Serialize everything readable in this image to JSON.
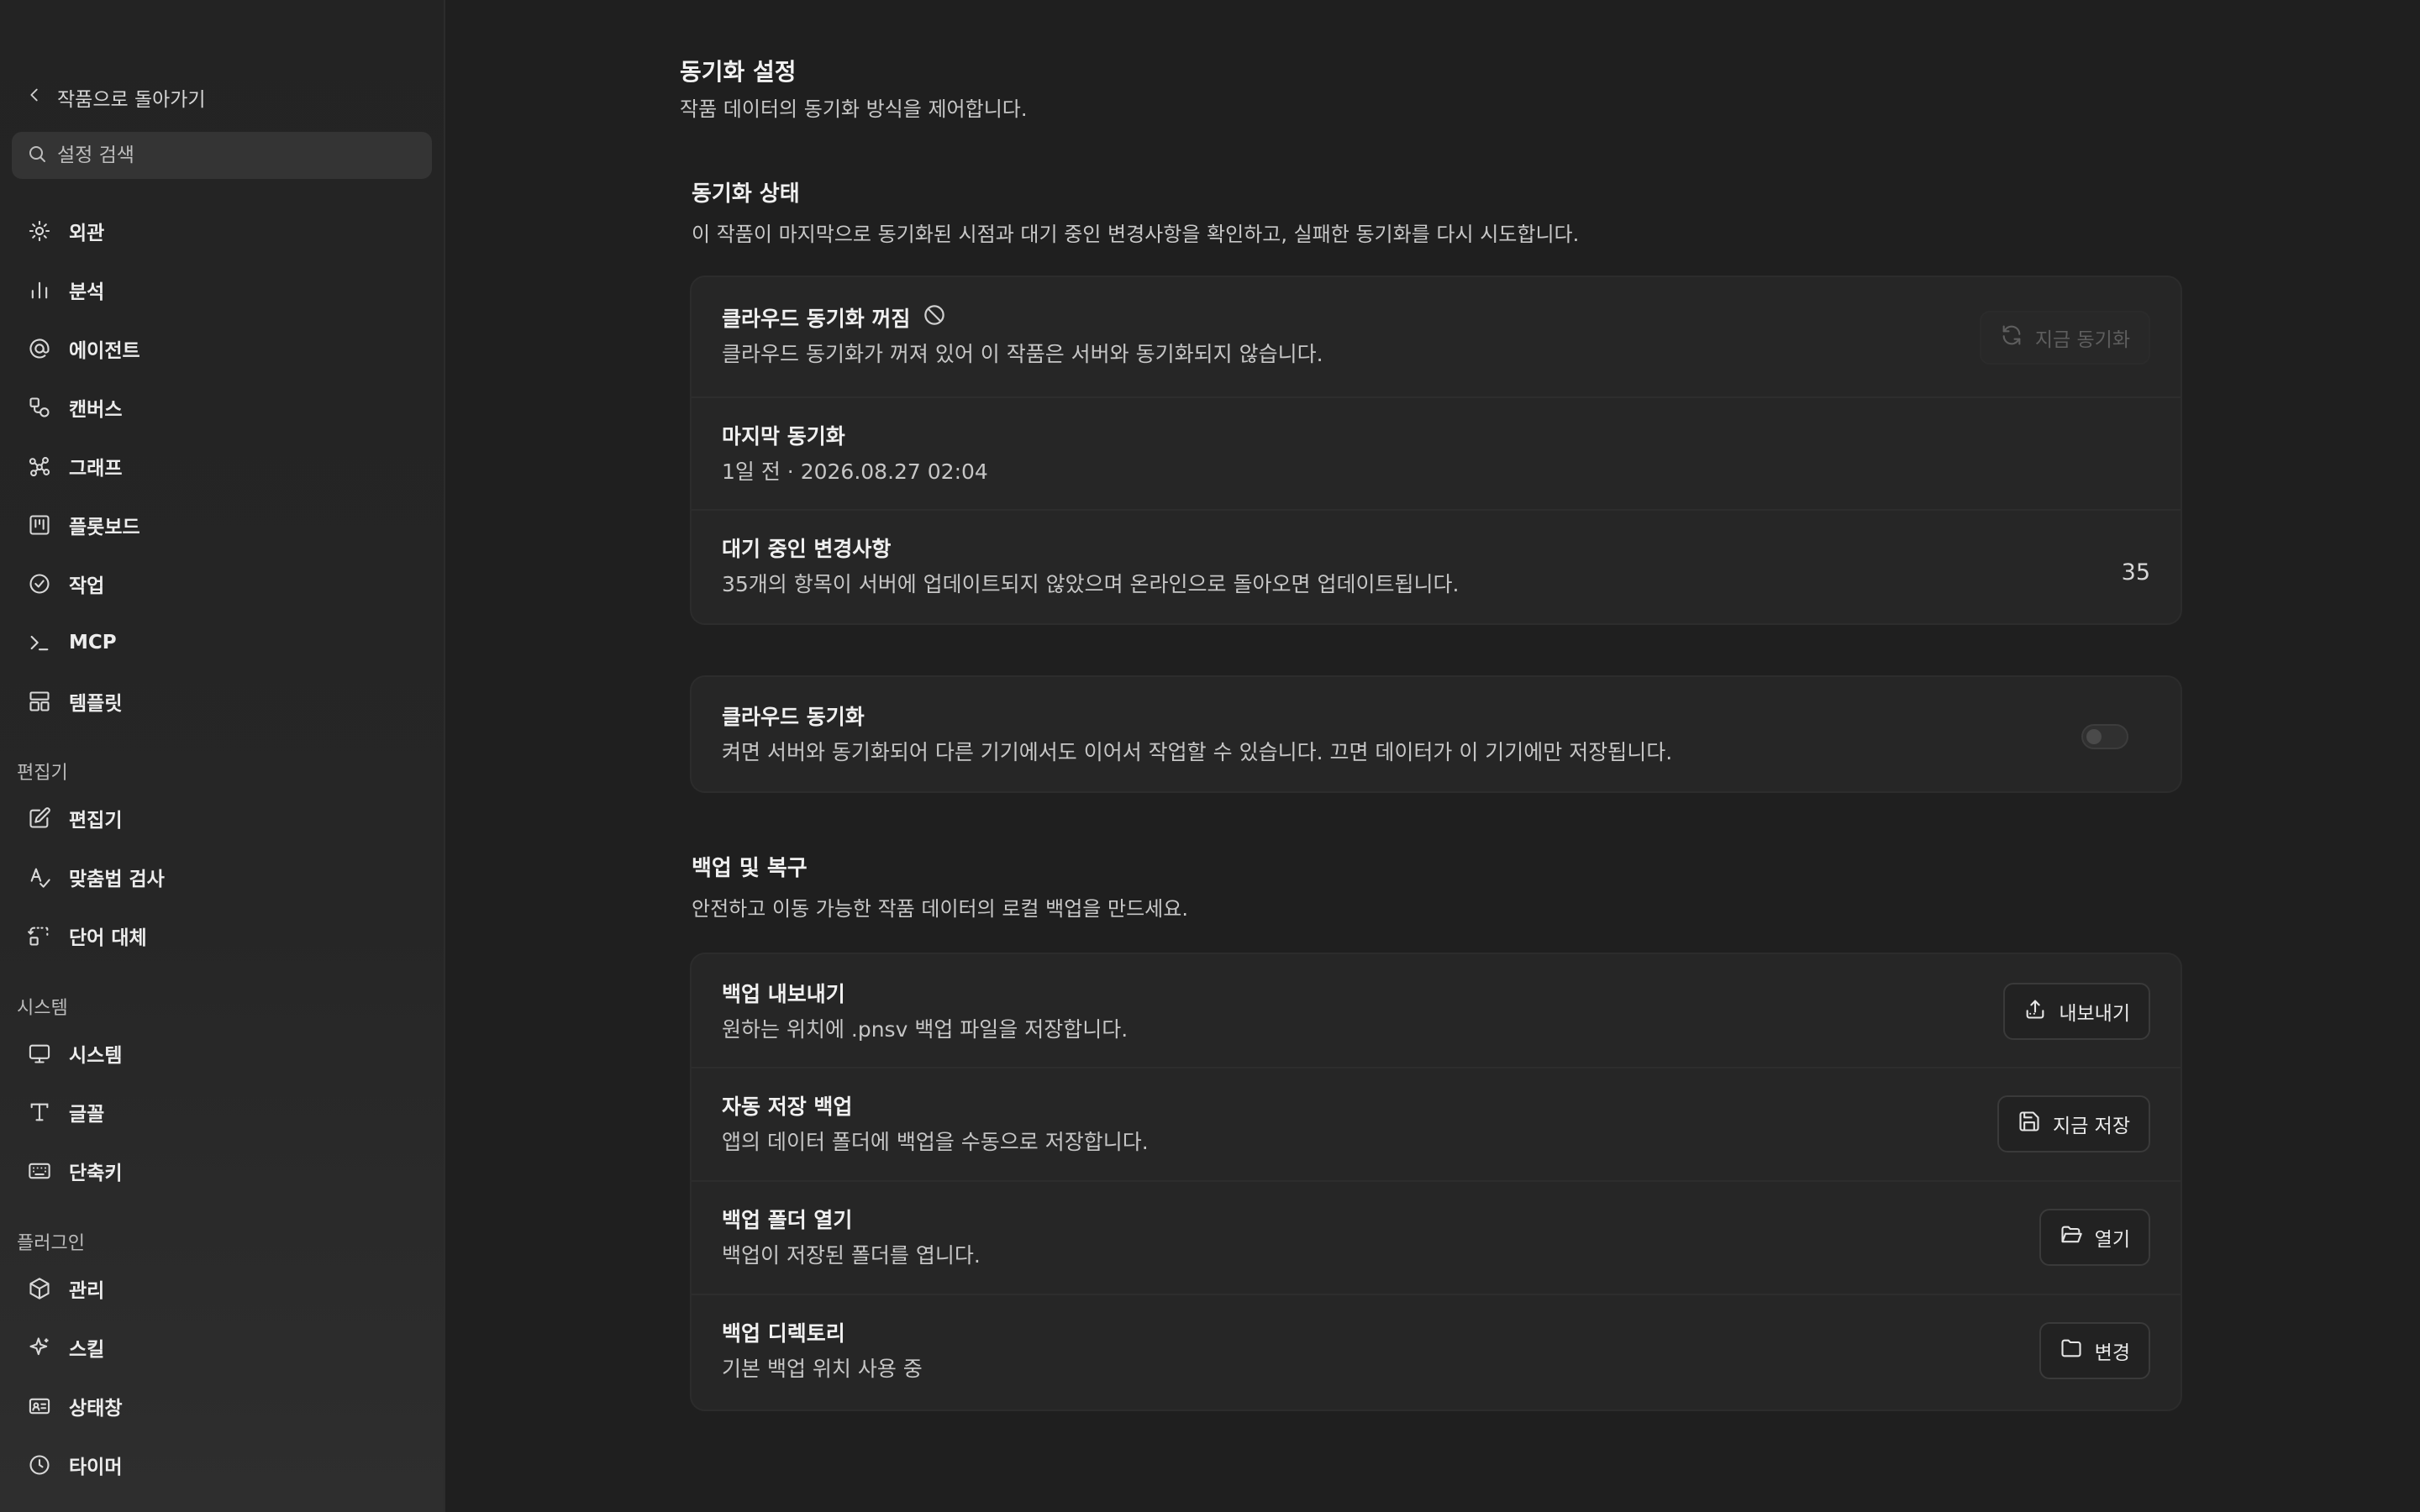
{
  "sidebar": {
    "back_label": "작품으로 돌아가기",
    "search_placeholder": "설정 검색",
    "groups": [
      {
        "label": "",
        "items": [
          {
            "label": "외관",
            "icon": "sun-icon"
          },
          {
            "label": "분석",
            "icon": "bar-chart-icon"
          },
          {
            "label": "에이전트",
            "icon": "at-sign-icon"
          },
          {
            "label": "캔버스",
            "icon": "canvas-shapes-icon"
          },
          {
            "label": "그래프",
            "icon": "graph-nodes-icon"
          },
          {
            "label": "플롯보드",
            "icon": "kanban-icon"
          },
          {
            "label": "작업",
            "icon": "check-circle-icon"
          },
          {
            "label": "MCP",
            "icon": "terminal-icon"
          },
          {
            "label": "템플릿",
            "icon": "layout-template-icon"
          }
        ]
      },
      {
        "label": "편집기",
        "items": [
          {
            "label": "편집기",
            "icon": "edit-square-icon"
          },
          {
            "label": "맞춤법 검사",
            "icon": "spell-check-icon"
          },
          {
            "label": "단어 대체",
            "icon": "replace-icon"
          }
        ]
      },
      {
        "label": "시스템",
        "items": [
          {
            "label": "시스템",
            "icon": "monitor-icon"
          },
          {
            "label": "글꼴",
            "icon": "type-icon"
          },
          {
            "label": "단축키",
            "icon": "keyboard-icon"
          }
        ]
      },
      {
        "label": "플러그인",
        "items": [
          {
            "label": "관리",
            "icon": "package-icon"
          },
          {
            "label": "스킬",
            "icon": "sparkles-icon"
          },
          {
            "label": "상태창",
            "icon": "id-card-icon"
          },
          {
            "label": "타이머",
            "icon": "clock-icon"
          }
        ]
      }
    ]
  },
  "main": {
    "title": "동기화 설정",
    "description": "작품 데이터의 동기화 방식을 제어합니다.",
    "sync_status": {
      "title": "동기화 상태",
      "description": "이 작품이 마지막으로 동기화된 시점과 대기 중인 변경사항을 확인하고, 실패한 동기화를 다시 시도합니다.",
      "cloud_off": {
        "title": "클라우드 동기화 꺼짐",
        "description": "클라우드 동기화가 꺼져 있어 이 작품은 서버와 동기화되지 않습니다.",
        "button": "지금 동기화"
      },
      "last_sync": {
        "title": "마지막 동기화",
        "value": "1일 전 · 2026.08.27 02:04"
      },
      "pending": {
        "title": "대기 중인 변경사항",
        "description": "35개의 항목이 서버에 업데이트되지 않았으며 온라인으로 돌아오면 업데이트됩니다.",
        "count": "35"
      }
    },
    "cloud_sync": {
      "title": "클라우드 동기화",
      "description": "켜면 서버와 동기화되어 다른 기기에서도 이어서 작업할 수 있습니다. 끄면 데이터가 이 기기에만 저장됩니다.",
      "enabled": false
    },
    "backup": {
      "title": "백업 및 복구",
      "description": "안전하고 이동 가능한 작품 데이터의 로컬 백업을 만드세요.",
      "rows": [
        {
          "title": "백업 내보내기",
          "description": "원하는 위치에 .pnsv 백업 파일을 저장합니다.",
          "button": "내보내기",
          "icon": "export-icon"
        },
        {
          "title": "자동 저장 백업",
          "description": "앱의 데이터 폴더에 백업을 수동으로 저장합니다.",
          "button": "지금 저장",
          "icon": "save-icon"
        },
        {
          "title": "백업 폴더 열기",
          "description": "백업이 저장된 폴더를 엽니다.",
          "button": "열기",
          "icon": "folder-open-icon"
        },
        {
          "title": "백업 디렉토리",
          "description": "기본 백업 위치 사용 중",
          "button": "변경",
          "icon": "folder-icon"
        }
      ]
    }
  }
}
